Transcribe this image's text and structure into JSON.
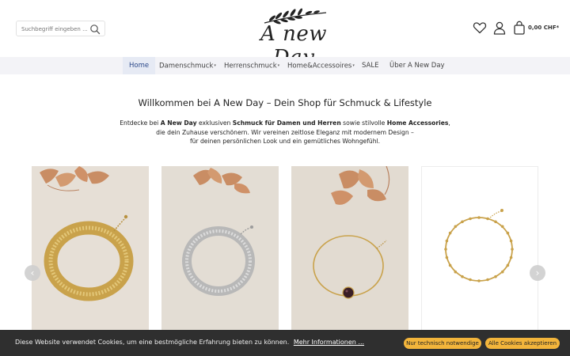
{
  "header": {
    "search_placeholder": "Suchbegriff eingeben ...",
    "logo_text": "A new Day",
    "cart_amount": "0,00 CHF*"
  },
  "nav": {
    "items": [
      {
        "label": "Home"
      },
      {
        "label": "Damenschmuck"
      },
      {
        "label": "Herrenschmuck"
      },
      {
        "label": "Home&Accessoires"
      },
      {
        "label": "SALE"
      },
      {
        "label": "Über A New Day"
      }
    ]
  },
  "welcome": {
    "title": "Willkommen bei A New Day – Dein Shop für Schmuck & Lifestyle",
    "intro": {
      "t1": "Entdecke bei ",
      "b1": "A New Day",
      "t2": " exklusiven ",
      "b2": "Schmuck für Damen und Herren",
      "t3": " sowie stilvolle ",
      "b3": "Home Accessories",
      "t4": ",",
      "line2": "die dein Zuhause verschönern. Wir vereinen zeitlose Eleganz mit modernem Design –",
      "line3": "für deinen persönlichen Look und ein gemütliches Wohngefühl."
    }
  },
  "carousel": {
    "products": [
      {
        "name": "gold-bracelet-wide"
      },
      {
        "name": "silver-bracelet"
      },
      {
        "name": "gold-bracelet-black-stone"
      },
      {
        "name": "gold-bracelet-beads"
      }
    ]
  },
  "cookie": {
    "message": "Diese Website verwendet Cookies, um eine bestmögliche Erfahrung bieten zu können.",
    "more_link": "Mehr Informationen ...",
    "btn_necessary": "Nur technisch notwendige",
    "btn_accept_all": "Alle Cookies akzeptieren"
  },
  "colors": {
    "accent_nav": "#2c4a8a",
    "cookie_bg": "#2f2f2f",
    "cookie_button": "#f3b53b",
    "nav_bg": "#f3f3f7"
  }
}
